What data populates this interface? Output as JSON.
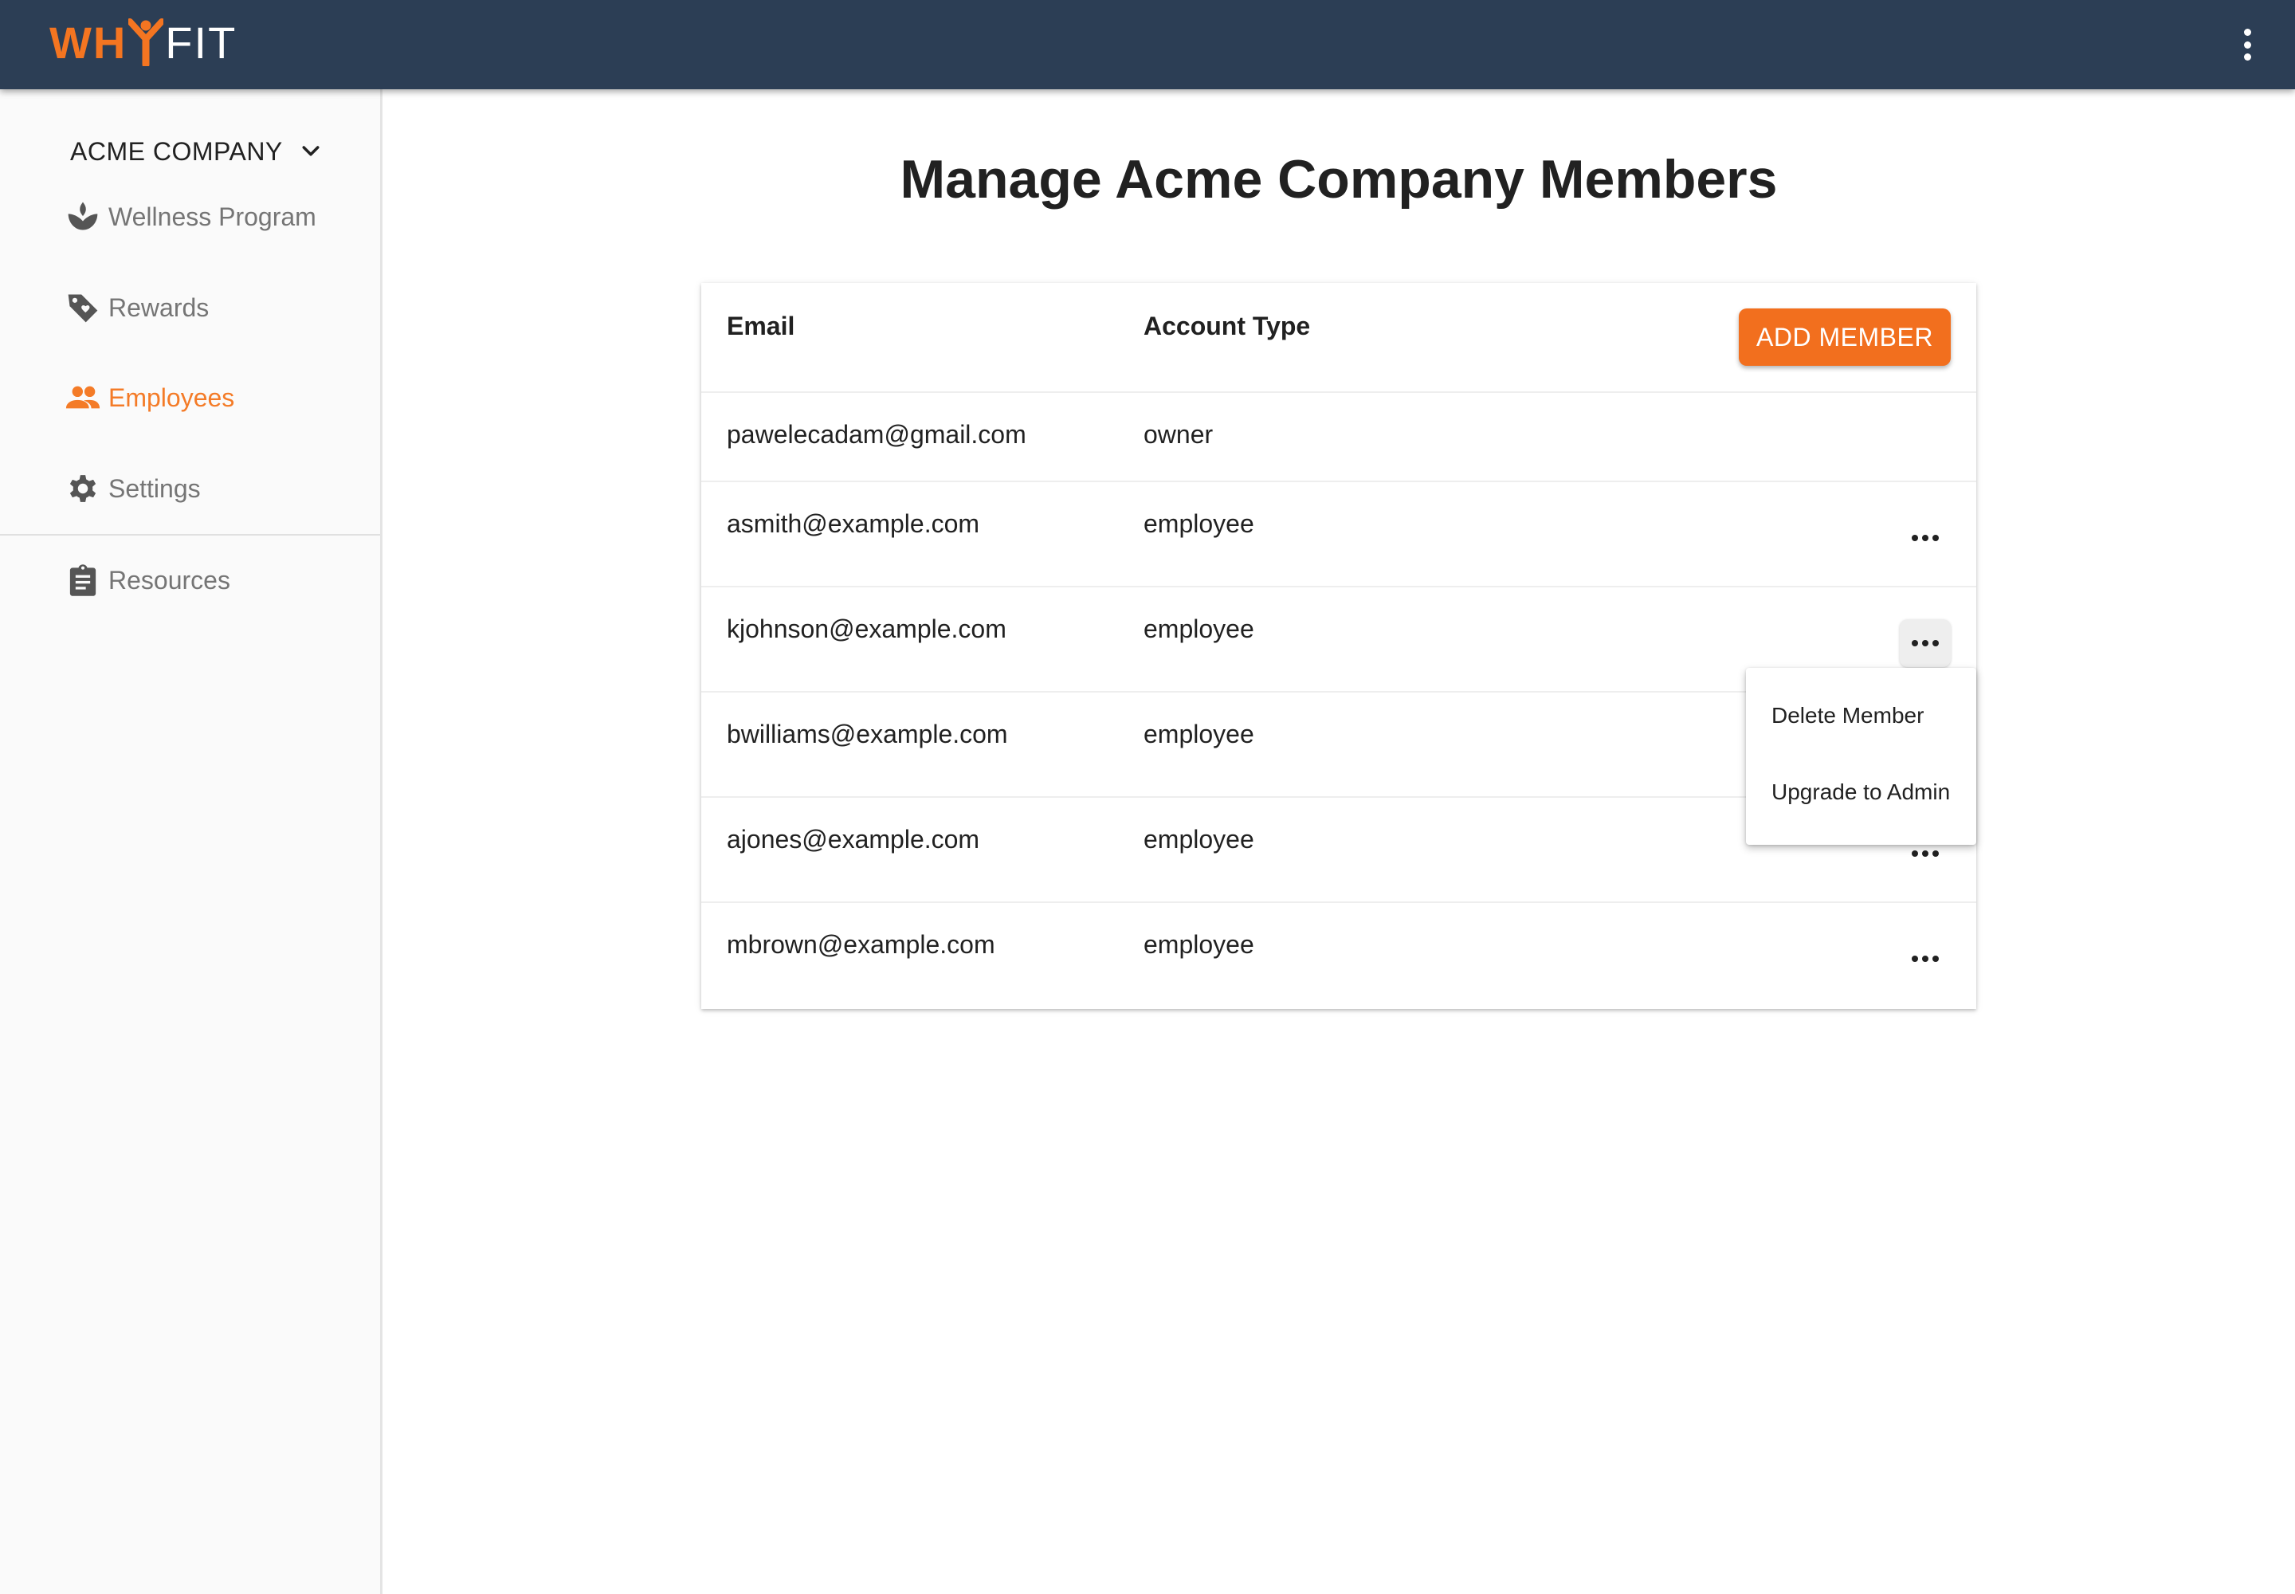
{
  "header": {
    "logo_why": "WH",
    "logo_fit": "FIT",
    "menu_icon": "kebab-vertical-icon"
  },
  "sidebar": {
    "company": "ACME COMPANY",
    "items": [
      {
        "label": "Wellness Program",
        "icon": "lotus-icon"
      },
      {
        "label": "Rewards",
        "icon": "tag-heart-icon"
      },
      {
        "label": "Employees",
        "icon": "people-icon",
        "active": true
      },
      {
        "label": "Settings",
        "icon": "gear-icon"
      },
      {
        "label": "Resources",
        "icon": "clipboard-icon"
      }
    ]
  },
  "main": {
    "title_prefix": "Manage ",
    "title_company": "Acme Company",
    "title_suffix": " Members",
    "table": {
      "headers": {
        "email": "Email",
        "account_type": "Account Type"
      },
      "add_button": "ADD MEMBER",
      "rows": [
        {
          "email": "pawelecadam@gmail.com",
          "type": "owner"
        },
        {
          "email": "asmith@example.com",
          "type": "employee"
        },
        {
          "email": "kjohnson@example.com",
          "type": "employee"
        },
        {
          "email": "bwilliams@example.com",
          "type": "employee"
        },
        {
          "email": "ajones@example.com",
          "type": "employee"
        },
        {
          "email": "mbrown@example.com",
          "type": "employee"
        }
      ]
    },
    "row_menu": {
      "items": [
        "Delete Member",
        "Upgrade to Admin"
      ]
    }
  },
  "colors": {
    "header_bg": "#2c3e55",
    "accent": "#f26f1e",
    "sidebar_bg": "#fafafa"
  }
}
